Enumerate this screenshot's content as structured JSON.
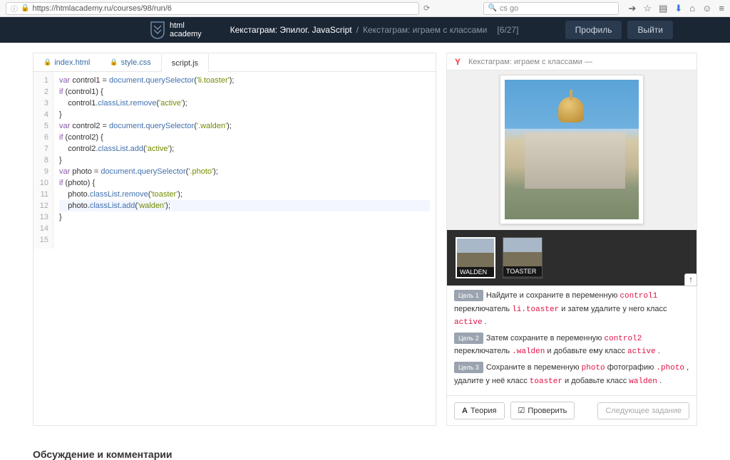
{
  "browser": {
    "url": "https://htmlacademy.ru/courses/98/run/6",
    "search_placeholder": "cs go",
    "reload_icon": "⟳",
    "search_icon": "🔍"
  },
  "header": {
    "logo_line1": "html",
    "logo_line2": "academy",
    "course": "Кекстаграм: Эпилог. JavaScript",
    "sep": "/",
    "task": "Кекстаграм: играем с классами",
    "progress": "[6/27]",
    "profile": "Профиль",
    "logout": "Выйти"
  },
  "tabs": {
    "index": "index.html",
    "style": "style.css",
    "script": "script.js"
  },
  "code": {
    "lines": [
      [
        {
          "t": "kw",
          "v": "var"
        },
        {
          "t": "var",
          "v": " control1 = "
        },
        {
          "t": "prop",
          "v": "document"
        },
        {
          "t": "var",
          "v": "."
        },
        {
          "t": "meth",
          "v": "querySelector"
        },
        {
          "t": "var",
          "v": "("
        },
        {
          "t": "str",
          "v": "'li.toaster'"
        },
        {
          "t": "var",
          "v": ");"
        }
      ],
      [
        {
          "t": "kw",
          "v": "if"
        },
        {
          "t": "var",
          "v": " (control1) {"
        }
      ],
      [
        {
          "t": "var",
          "v": "    control1."
        },
        {
          "t": "prop",
          "v": "classList"
        },
        {
          "t": "var",
          "v": "."
        },
        {
          "t": "meth",
          "v": "remove"
        },
        {
          "t": "var",
          "v": "("
        },
        {
          "t": "str",
          "v": "'active'"
        },
        {
          "t": "var",
          "v": ");"
        }
      ],
      [
        {
          "t": "var",
          "v": "}"
        }
      ],
      [
        {
          "t": "var",
          "v": ""
        }
      ],
      [
        {
          "t": "kw",
          "v": "var"
        },
        {
          "t": "var",
          "v": " control2 = "
        },
        {
          "t": "prop",
          "v": "document"
        },
        {
          "t": "var",
          "v": "."
        },
        {
          "t": "meth",
          "v": "querySelector"
        },
        {
          "t": "var",
          "v": "("
        },
        {
          "t": "str",
          "v": "'.walden'"
        },
        {
          "t": "var",
          "v": ");"
        }
      ],
      [
        {
          "t": "kw",
          "v": "if"
        },
        {
          "t": "var",
          "v": " (control2) {"
        }
      ],
      [
        {
          "t": "var",
          "v": "    control2."
        },
        {
          "t": "prop",
          "v": "classList"
        },
        {
          "t": "var",
          "v": "."
        },
        {
          "t": "meth",
          "v": "add"
        },
        {
          "t": "var",
          "v": "("
        },
        {
          "t": "str",
          "v": "'active'"
        },
        {
          "t": "var",
          "v": ");"
        }
      ],
      [
        {
          "t": "var",
          "v": "}"
        }
      ],
      [
        {
          "t": "var",
          "v": ""
        }
      ],
      [
        {
          "t": "kw",
          "v": "var"
        },
        {
          "t": "var",
          "v": " photo = "
        },
        {
          "t": "prop",
          "v": "document"
        },
        {
          "t": "var",
          "v": "."
        },
        {
          "t": "meth",
          "v": "querySelector"
        },
        {
          "t": "var",
          "v": "("
        },
        {
          "t": "str",
          "v": "'.photo'"
        },
        {
          "t": "var",
          "v": ");"
        }
      ],
      [
        {
          "t": "kw",
          "v": "if"
        },
        {
          "t": "var",
          "v": " (photo) {"
        }
      ],
      [
        {
          "t": "var",
          "v": "    photo."
        },
        {
          "t": "prop",
          "v": "classList"
        },
        {
          "t": "var",
          "v": "."
        },
        {
          "t": "meth",
          "v": "remove"
        },
        {
          "t": "var",
          "v": "("
        },
        {
          "t": "str",
          "v": "'toaster'"
        },
        {
          "t": "var",
          "v": ");"
        }
      ],
      [
        {
          "t": "var",
          "v": "    photo."
        },
        {
          "t": "prop",
          "v": "classList"
        },
        {
          "t": "var",
          "v": "."
        },
        {
          "t": "meth",
          "v": "add"
        },
        {
          "t": "var",
          "v": "("
        },
        {
          "t": "str",
          "v": "'walden'"
        },
        {
          "t": "var",
          "v": ");"
        }
      ],
      [
        {
          "t": "var",
          "v": "}"
        }
      ]
    ],
    "cursor_line": 14
  },
  "preview": {
    "tab_title": "Кекстаграм: играем с классами —",
    "thumbs": [
      {
        "label": "WALDEN",
        "selected": true
      },
      {
        "label": "TOASTER",
        "selected": false
      }
    ]
  },
  "goals": [
    {
      "badge": "Цель 1",
      "parts": [
        "Найдите и сохраните в переменную ",
        {
          "c": "control1"
        },
        " переключатель ",
        {
          "c": "li.toaster"
        },
        " и затем удалите у него класс ",
        {
          "c": "active"
        },
        " ."
      ]
    },
    {
      "badge": "Цель 2",
      "parts": [
        "Затем сохраните в переменную ",
        {
          "c": "control2"
        },
        " переключатель ",
        {
          "c": ".walden"
        },
        " и добавьте ему класс ",
        {
          "c": "active"
        },
        " ."
      ]
    },
    {
      "badge": "Цель 3",
      "parts": [
        "Сохраните в переменную ",
        {
          "c": "photo"
        },
        " фотографию ",
        {
          "c": ".photo"
        },
        " , удалите у неё класс ",
        {
          "c": "toaster"
        },
        " и добавьте класс ",
        {
          "c": "walden"
        },
        " ."
      ]
    }
  ],
  "actions": {
    "theory": "Теория",
    "check": "Проверить",
    "next": "Следующее задание"
  },
  "footer": {
    "comments": "Обсуждение и комментарии"
  }
}
